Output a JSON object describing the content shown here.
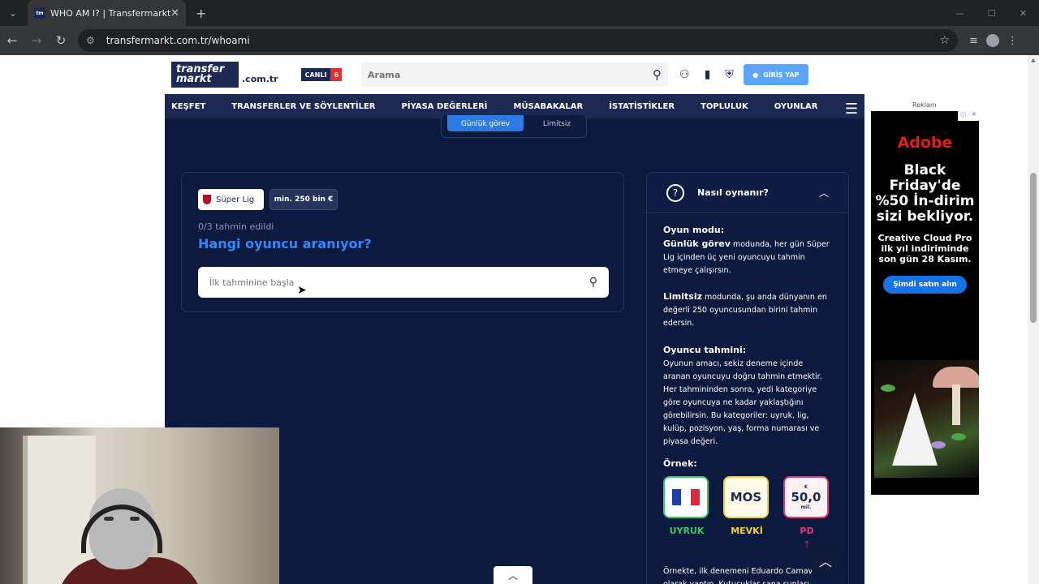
{
  "browser": {
    "tab_title": "WHO AM I? | Transfermarkt",
    "favicon_text": "tm",
    "url": "transfermarkt.com.tr/whoami"
  },
  "site": {
    "logo_line1": "transfer",
    "logo_line2": "markt",
    "domain_suffix": ".com.tr",
    "live_label": "CANLI",
    "live_count": "6",
    "search_placeholder": "Arama",
    "login_label": "GİRİŞ YAP",
    "nav": [
      "KEŞFET",
      "TRANSFERLER VE SÖYLENTİLER",
      "PİYASA DEĞERLERİ",
      "MÜSABAKALAR",
      "İSTATİSTİKLER",
      "TOPLULUK",
      "OYUNLAR"
    ]
  },
  "mode_toggle": {
    "daily": "Günlük görev",
    "unlimited": "Limitsiz"
  },
  "game": {
    "league_chip": "Süper Lig",
    "value_chip": "min. 250 bin €",
    "guess_count": "0/3 tahmin edildi",
    "question": "Hangi oyuncu aranıyor?",
    "input_placeholder": "İlk tahminine başla"
  },
  "help": {
    "title": "Nasıl oynanır?",
    "mode_heading": "Oyun modu:",
    "daily_bold": "Günlük görev",
    "daily_text": " modunda, her gün Süper Lig içinden üç yeni oyuncuyu tahmin etmeye çalışırsın.",
    "unlimited_bold": "Limitsiz",
    "unlimited_text": " modunda, şu anda dünyanın en değerli 250 oyuncusundan birini tahmin edersin.",
    "guess_heading": "Oyuncu tahmini:",
    "guess_text": "Oyunun amacı, sekiz deneme içinde aranan oyuncuyu doğru tahmin etmektir. Her tahmininden sonra, yedi kategoriye göre oyuncuya ne kadar yaklaştığını görebilirsin. Bu kategoriler: uyruk, lig, kulüp, pozisyon, yaş, forma numarası ve piyasa değeri.",
    "example_heading": "Örnek:",
    "ex_nationality_label": "UYRUK",
    "ex_position_value": "MOS",
    "ex_position_label": "MEVKİ",
    "ex_value_currency": "€",
    "ex_value_amount": "50,0",
    "ex_value_unit": "mil.",
    "ex_value_label": "PD",
    "footer_text": "Örnekte, ilk denemeni Eduardo Camav... olarak yaptın. Kutucuklar sana şunları..."
  },
  "ad": {
    "label": "Reklam",
    "brand": "Adobe",
    "headline": "Black Friday'de %50 İn-dirim sizi bekliyor.",
    "subline": "Creative Cloud Pro ilk yıl indiriminde son gün 28 Kasım.",
    "cta": "Şimdi satın alın"
  },
  "colors": {
    "site_bg": "#0d1a3f",
    "accent_blue": "#2b8bff",
    "nationality_green": "#38c966",
    "position_yellow": "#f2d22e",
    "value_pink": "#e63a6c"
  }
}
